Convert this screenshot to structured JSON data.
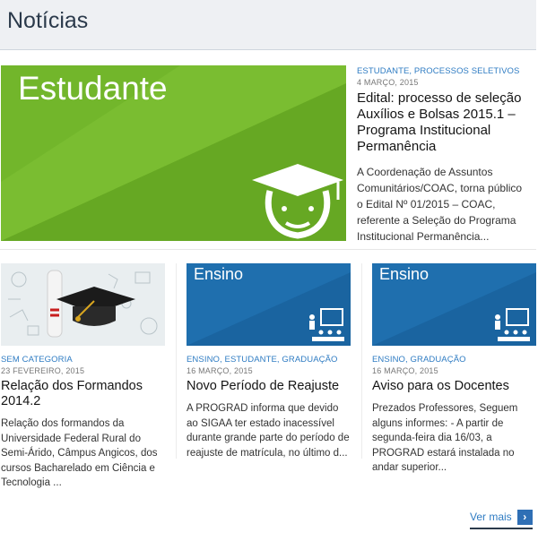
{
  "header": {
    "title": "Notícias"
  },
  "featured": {
    "image_label": "Estudante",
    "category": "ESTUDANTE, PROCESSOS SELETIVOS",
    "date": "4 MARÇO, 2015",
    "title": "Edital: processo de seleção Auxílios e Bolsas 2015.1 – Programa Institucional Permanência",
    "excerpt": "A Coordenação de Assuntos Comunitários/COAC, torna público o Edital Nº 01/2015 – COAC, referente a Seleção do Programa Institucional Permanência..."
  },
  "cards": [
    {
      "category": "SEM CATEGORIA",
      "date": "23 FEVEREIRO, 2015",
      "title": "Relação dos Formandos 2014.2",
      "excerpt": "Relação dos formandos da Universidade Federal Rural do Semi-Árido, Câmpus Angicos, dos cursos Bacharelado em Ciência e Tecnologia ..."
    },
    {
      "image_label": "Ensino",
      "category": "ENSINO, ESTUDANTE, GRADUAÇÃO",
      "date": "16 MARÇO, 2015",
      "title": "Novo Período de Reajuste",
      "excerpt": "A PROGRAD informa que devido ao SIGAA ter estado inacessível durante grande parte do período de reajuste de matrícula, no último d..."
    },
    {
      "image_label": "Ensino",
      "category": "ENSINO, GRADUAÇÃO",
      "date": "16 MARÇO, 2015",
      "title": "Aviso para os Docentes",
      "excerpt": "Prezados Professores, Seguem alguns informes: -  A partir de segunda-feira dia 16/03, a PROGRAD estará instalada no andar superior..."
    }
  ],
  "footer": {
    "ver_mais": "Ver mais",
    "arrow_icon": "chevron-right-icon"
  },
  "colors": {
    "green": "#72b62b",
    "blue": "#1f6fae",
    "link": "#2f7cc3"
  }
}
